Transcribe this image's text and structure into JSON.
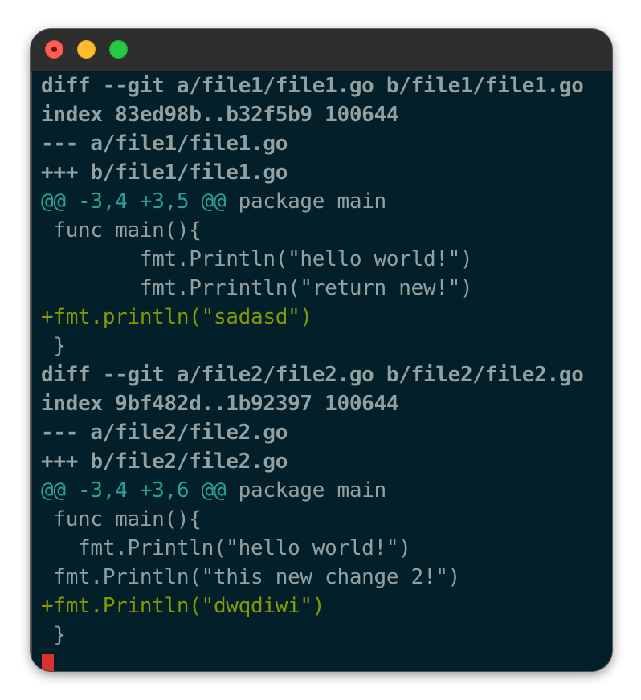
{
  "window": {
    "controls": [
      "close",
      "minimize",
      "zoom"
    ]
  },
  "terminal": {
    "lines": [
      "diff --git a/file1/file1.go b/file1/file1.go",
      "index 83ed98b..b32f5b9 100644",
      "--- a/file1/file1.go",
      "+++ b/file1/file1.go",
      "@@ -3,4 +3,5 @@",
      " package main",
      " func main(){",
      "        fmt.Println(\"hello world!\")",
      "        fmt.Prrintln(\"return new!\")",
      "+fmt.println(\"sadasd\")",
      " }",
      "diff --git a/file2/file2.go b/file2/file2.go",
      "index 9bf482d..1b92397 100644",
      "--- a/file2/file2.go",
      "+++ b/file2/file2.go",
      "@@ -3,4 +3,6 @@",
      " package main",
      " func main(){",
      "   fmt.Println(\"hello world!\")",
      " fmt.Println(\"this new change 2!\")",
      "+fmt.Println(\"dwqdiwi\")",
      " }"
    ]
  },
  "colors": {
    "background": "#03202a",
    "titlebar": "#2e2e2e",
    "meta_text": "#93a1a1",
    "hunk_header": "#2aa198",
    "context_text": "#93a1a1",
    "added_text": "#859900",
    "cursor": "#dc322f"
  }
}
